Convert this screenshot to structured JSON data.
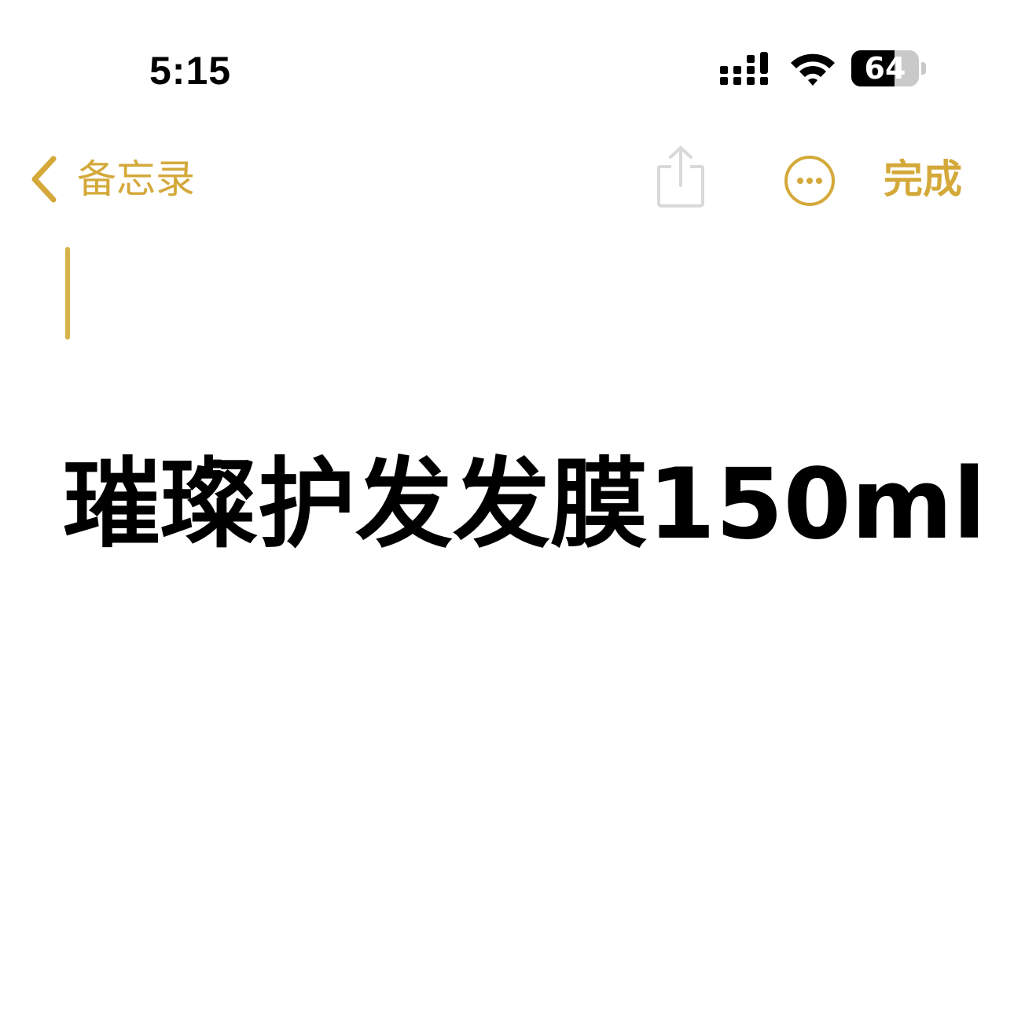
{
  "status_bar": {
    "time": "5:15",
    "battery_level": "64",
    "battery_fraction": 0.64,
    "icons": [
      "cellular-signal-icon",
      "wifi-icon",
      "battery-icon"
    ]
  },
  "nav": {
    "back_label": "备忘录",
    "done_label": "完成",
    "icons": [
      "chevron-left-icon",
      "share-icon",
      "more-icon"
    ]
  },
  "note": {
    "title": "璀璨护发发膜150ml"
  },
  "colors": {
    "accent": "#d4a93a",
    "text": "#000000",
    "background": "#ffffff",
    "disabled": "#d9d9d9"
  }
}
